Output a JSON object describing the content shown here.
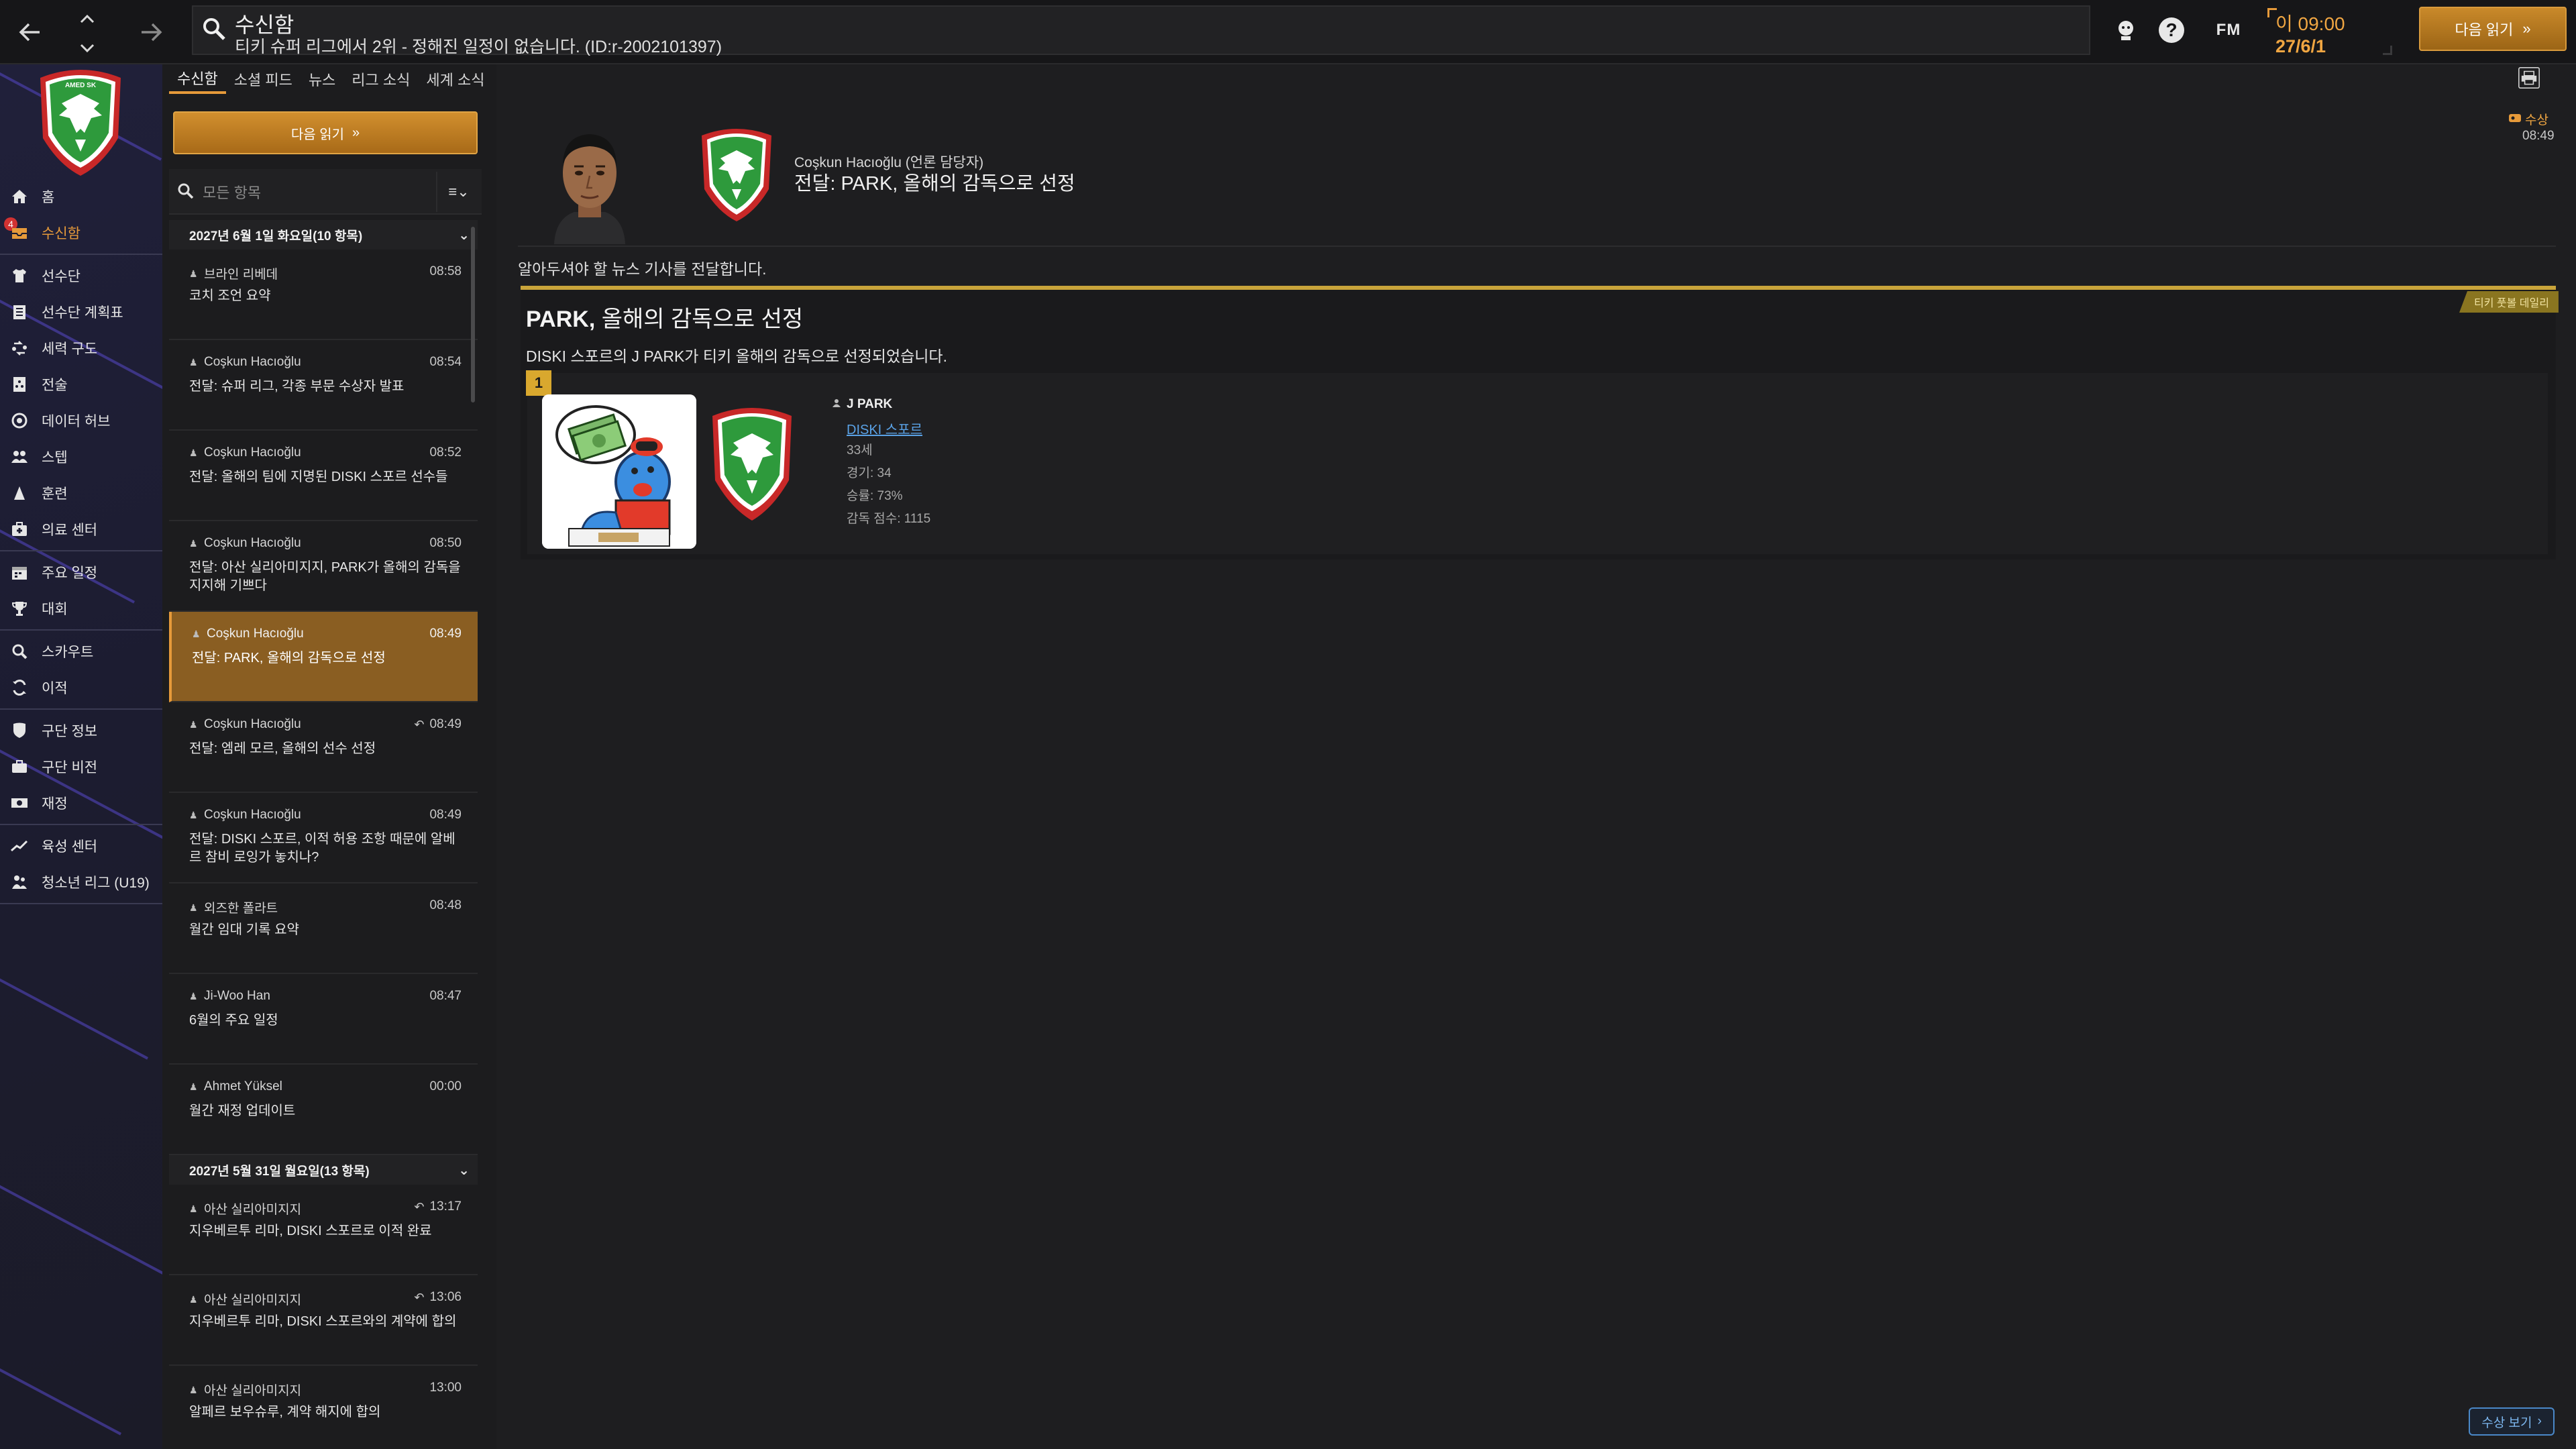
{
  "topbar": {
    "search_title": "수신함",
    "search_subtitle": "티키 슈퍼 리그에서 2위 - 정해진 일정이 없습니다. (ID:r-2002101397)",
    "fm_label": "FM",
    "time": "이 09:00",
    "date": "27/6/1",
    "continue_label": "다음 읽기",
    "continue_arrow": "»"
  },
  "sidebar": {
    "crest_text": "AMED SK",
    "badge_count": "4",
    "items": [
      {
        "label": "홈",
        "icon": "home-icon"
      },
      {
        "label": "수신함",
        "icon": "inbox-icon"
      },
      {
        "label": "선수단",
        "icon": "squad-icon"
      },
      {
        "label": "선수단 계획표",
        "icon": "squad-plan-icon"
      },
      {
        "label": "세력 구도",
        "icon": "dynamics-icon"
      },
      {
        "label": "전술",
        "icon": "tactics-icon"
      },
      {
        "label": "데이터 허브",
        "icon": "data-hub-icon"
      },
      {
        "label": "스텝",
        "icon": "staff-icon"
      },
      {
        "label": "훈련",
        "icon": "training-icon"
      },
      {
        "label": "의료 센터",
        "icon": "medical-icon"
      },
      {
        "label": "주요 일정",
        "icon": "schedule-icon"
      },
      {
        "label": "대회",
        "icon": "trophy-icon"
      },
      {
        "label": "스카우트",
        "icon": "scouting-icon"
      },
      {
        "label": "이적",
        "icon": "transfers-icon"
      },
      {
        "label": "구단 정보",
        "icon": "club-info-icon"
      },
      {
        "label": "구단 비전",
        "icon": "club-vision-icon"
      },
      {
        "label": "재정",
        "icon": "finances-icon"
      },
      {
        "label": "육성 센터",
        "icon": "development-icon"
      },
      {
        "label": "청소년 리그 (U19)",
        "icon": "youth-icon"
      }
    ]
  },
  "tabs": [
    "수신함",
    "소셜 피드",
    "뉴스",
    "리그 소식",
    "세계 소식"
  ],
  "list": {
    "continue_label": "다음 읽기",
    "continue_arrow": "»",
    "filter_placeholder": "모든 항목",
    "sort_icon": "≡⌄",
    "group1": "2027년 6월 1일 화요일(10 항목)",
    "group2": "2027년 5월 31일 월요일(13 항목)",
    "messages1": [
      {
        "from": "브라인 리베데",
        "time": "08:58",
        "subject": "코치 조언 요약",
        "reply": ""
      },
      {
        "from": "Coşkun Hacıoğlu",
        "time": "08:54",
        "subject": "전달: 슈퍼 리그, 각종 부문 수상자 발표",
        "reply": ""
      },
      {
        "from": "Coşkun Hacıoğlu",
        "time": "08:52",
        "subject": "전달: 올해의 팀에 지명된 DISKI 스포르 선수들",
        "reply": ""
      },
      {
        "from": "Coşkun Hacıoğlu",
        "time": "08:50",
        "subject": "전달: 아산 실리아미지지, PARK가 올해의 감독을 지지해 기쁘다",
        "reply": ""
      },
      {
        "from": "Coşkun Hacıoğlu",
        "time": "08:49",
        "subject": "전달: PARK, 올해의 감독으로 선정",
        "reply": ""
      },
      {
        "from": "Coşkun Hacıoğlu",
        "time": "08:49",
        "subject": "전달: 엠레 모르, 올해의 선수 선정",
        "reply": "↶"
      },
      {
        "from": "Coşkun Hacıoğlu",
        "time": "08:49",
        "subject": "전달: DISKI 스포르, 이적 허용 조항 때문에 알베르 참비 로잉가 놓치나?",
        "reply": ""
      },
      {
        "from": "외즈한 폴라트",
        "time": "08:48",
        "subject": "월간 임대 기록 요약",
        "reply": ""
      },
      {
        "from": "Ji-Woo Han",
        "time": "08:47",
        "subject": "6월의 주요 일정",
        "reply": ""
      },
      {
        "from": "Ahmet Yüksel",
        "time": "00:00",
        "subject": "월간 재정 업데이트",
        "reply": ""
      }
    ],
    "messages2": [
      {
        "from": "아산 실리아미지지",
        "time": "13:17",
        "subject": "지우베르투 리마, DISKI 스포르로 이적 완료",
        "reply": "↶"
      },
      {
        "from": "아산 실리아미지지",
        "time": "13:06",
        "subject": "지우베르투 리마, DISKI 스포르와의 계약에 합의",
        "reply": "↶"
      },
      {
        "from": "아산 실리아미지지",
        "time": "13:00",
        "subject": "알페르 보우슈루, 계약 해지에 합의",
        "reply": ""
      }
    ]
  },
  "detail": {
    "sender": "Coşkun Hacıoğlu (언론 담당자)",
    "subject": "전달: PARK, 올해의 감독으로 선정",
    "award_tag": "수상",
    "award_time": "08:49",
    "intro": "알아두셔야 할 뉴스 기사를 전달합니다.",
    "source_tag": "티키 풋볼 데일리",
    "news_title_bold": "PARK,",
    "news_title_rest": " 올해의 감독으로 선정",
    "news_body": "DISKI 스포르의 J PARK가 티키 올해의 감독으로 선정되었습니다.",
    "rank": "1",
    "winner": {
      "name": "J PARK",
      "club": "DISKI 스포르",
      "age": "33세",
      "games": "경기: 34",
      "win_rate": "승률: 73%",
      "score": "감독 점수: 1115"
    },
    "award_button": "수상 보기",
    "award_button_arrow": "›"
  },
  "colors": {
    "accent": "#e69a3a",
    "gold": "#c9a43a",
    "link": "#5aa2e6",
    "crest_green": "#2e9a3c",
    "crest_red": "#c82828"
  }
}
